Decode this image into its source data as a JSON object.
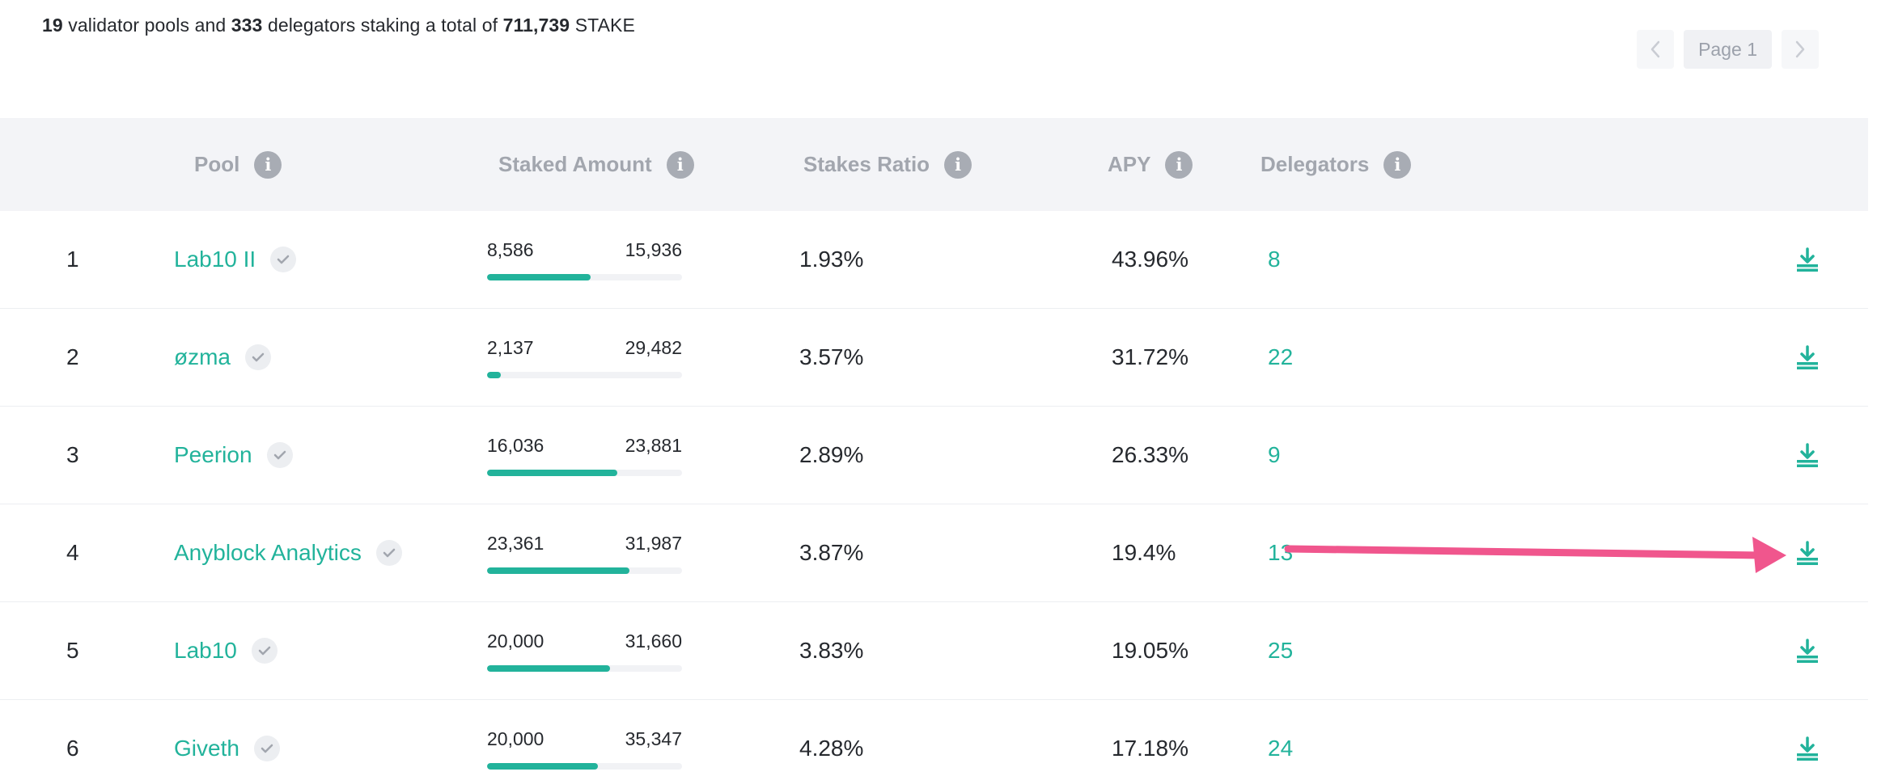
{
  "summary": {
    "pools_count": "19",
    "pools_text": " validator pools and ",
    "delegators_count": "333",
    "delegators_text": " delegators staking a total of ",
    "total": "711,739",
    "unit": " STAKE"
  },
  "pager": {
    "prev_icon": "chevron-left-icon",
    "page_label": "Page 1",
    "next_icon": "chevron-right-icon"
  },
  "table": {
    "headers": {
      "pool": "Pool",
      "staked_amount": "Staked Amount",
      "stakes_ratio": "Stakes Ratio",
      "apy": "APY",
      "delegators": "Delegators"
    },
    "rows": [
      {
        "rank": "1",
        "pool": "Lab10 II",
        "staked": "8,586",
        "limit": "15,936",
        "fill": 0.53,
        "ratio": "1.93%",
        "apy": "43.96%",
        "delegators": "8"
      },
      {
        "rank": "2",
        "pool": "øzma",
        "staked": "2,137",
        "limit": "29,482",
        "fill": 0.07,
        "ratio": "3.57%",
        "apy": "31.72%",
        "delegators": "22"
      },
      {
        "rank": "3",
        "pool": "Peerion",
        "staked": "16,036",
        "limit": "23,881",
        "fill": 0.67,
        "ratio": "2.89%",
        "apy": "26.33%",
        "delegators": "9"
      },
      {
        "rank": "4",
        "pool": "Anyblock Analytics",
        "staked": "23,361",
        "limit": "31,987",
        "fill": 0.73,
        "ratio": "3.87%",
        "apy": "19.4%",
        "delegators": "13"
      },
      {
        "rank": "5",
        "pool": "Lab10",
        "staked": "20,000",
        "limit": "31,660",
        "fill": 0.63,
        "ratio": "3.83%",
        "apy": "19.05%",
        "delegators": "25"
      },
      {
        "rank": "6",
        "pool": "Giveth",
        "staked": "20,000",
        "limit": "35,347",
        "fill": 0.57,
        "ratio": "4.28%",
        "apy": "17.18%",
        "delegators": "24"
      }
    ]
  },
  "colors": {
    "accent": "#22b39b",
    "annotation_arrow": "#f0568d",
    "header_bg": "#f3f4f7"
  },
  "icons": {
    "info": "info-icon",
    "verified": "check-icon",
    "download": "download-icon"
  }
}
